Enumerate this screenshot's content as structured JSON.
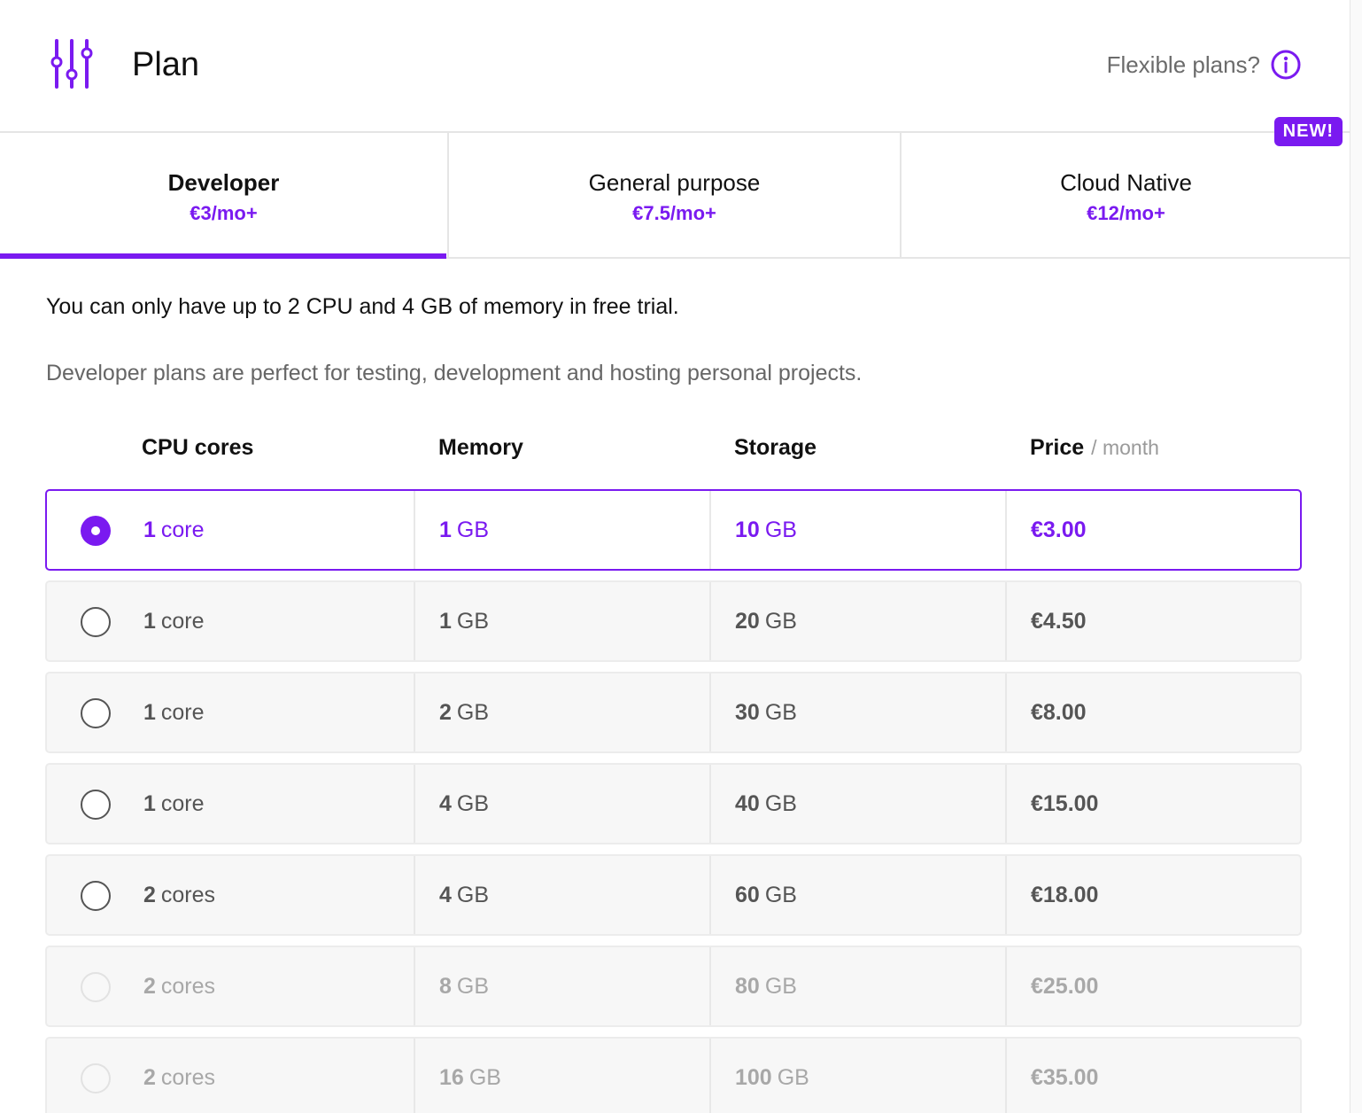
{
  "header": {
    "title": "Plan",
    "flexible_link": "Flexible plans?",
    "icons": {
      "plan": "sliders-icon",
      "info": "info-icon"
    }
  },
  "tabs": [
    {
      "name": "Developer",
      "price": "€3/mo+",
      "active": true
    },
    {
      "name": "General purpose",
      "price": "€7.5/mo+",
      "active": false
    },
    {
      "name": "Cloud Native",
      "price": "€12/mo+",
      "active": false,
      "badge": "NEW!"
    }
  ],
  "notice": "You can only have up to 2 CPU and 4 GB of memory in free trial.",
  "description": "Developer plans are perfect for testing, development and hosting personal projects.",
  "columns": {
    "cpu": "CPU cores",
    "memory": "Memory",
    "storage": "Storage",
    "price": "Price",
    "price_suffix": "/ month"
  },
  "plans": [
    {
      "cpu_num": "1",
      "cpu_unit": "core",
      "mem_num": "1",
      "mem_unit": "GB",
      "sto_num": "10",
      "sto_unit": "GB",
      "price": "€3.00",
      "state": "selected"
    },
    {
      "cpu_num": "1",
      "cpu_unit": "core",
      "mem_num": "1",
      "mem_unit": "GB",
      "sto_num": "20",
      "sto_unit": "GB",
      "price": "€4.50",
      "state": "available"
    },
    {
      "cpu_num": "1",
      "cpu_unit": "core",
      "mem_num": "2",
      "mem_unit": "GB",
      "sto_num": "30",
      "sto_unit": "GB",
      "price": "€8.00",
      "state": "available"
    },
    {
      "cpu_num": "1",
      "cpu_unit": "core",
      "mem_num": "4",
      "mem_unit": "GB",
      "sto_num": "40",
      "sto_unit": "GB",
      "price": "€15.00",
      "state": "available"
    },
    {
      "cpu_num": "2",
      "cpu_unit": "cores",
      "mem_num": "4",
      "mem_unit": "GB",
      "sto_num": "60",
      "sto_unit": "GB",
      "price": "€18.00",
      "state": "available"
    },
    {
      "cpu_num": "2",
      "cpu_unit": "cores",
      "mem_num": "8",
      "mem_unit": "GB",
      "sto_num": "80",
      "sto_unit": "GB",
      "price": "€25.00",
      "state": "disabled"
    },
    {
      "cpu_num": "2",
      "cpu_unit": "cores",
      "mem_num": "16",
      "mem_unit": "GB",
      "sto_num": "100",
      "sto_unit": "GB",
      "price": "€35.00",
      "state": "disabled"
    }
  ],
  "colors": {
    "accent": "#7a1af0",
    "text": "#111111",
    "muted": "#666666",
    "row_bg": "#f7f7f7",
    "border": "#e5e5e5"
  }
}
